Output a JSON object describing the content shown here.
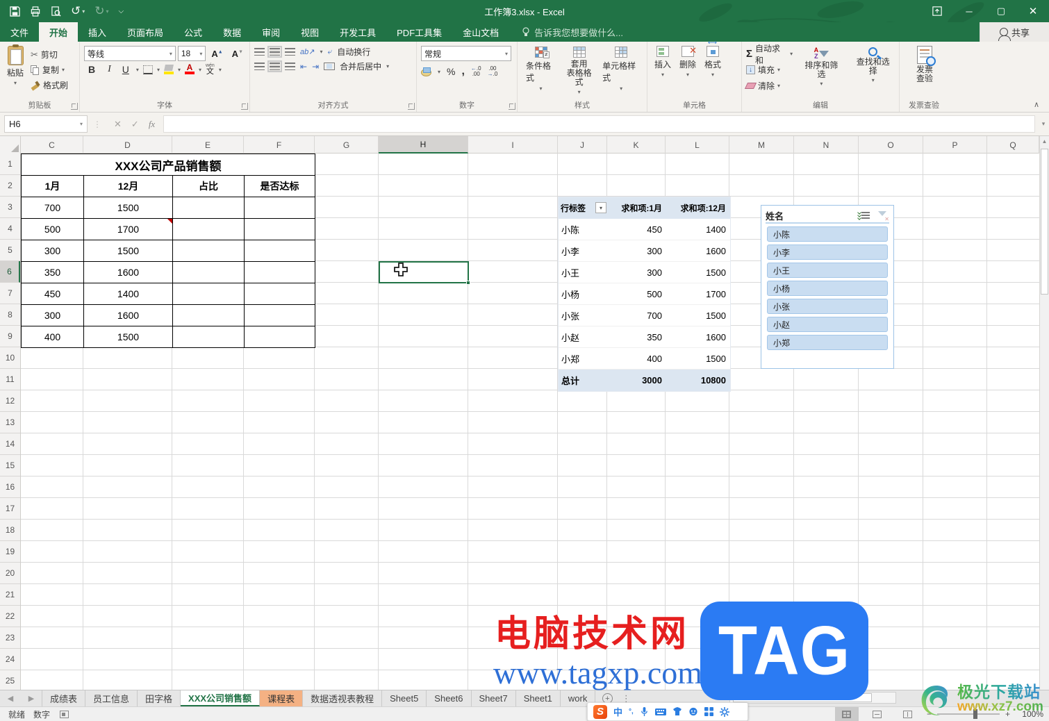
{
  "colors": {
    "excel_green": "#217346",
    "ribbon_bg": "#f4f2ee",
    "pivot_header_bg": "#dce6f1",
    "slicer_border_blue": "#9dc3e6",
    "slicer_item_bg": "#c9ddf1",
    "sheet_tab_highlight": "#f4b183",
    "watermark_red": "#e61f1f",
    "watermark_url_blue": "#2e6fd6",
    "tag_badge_blue": "#2b7bf3"
  },
  "titlebar": {
    "title": "工作簿3.xlsx - Excel"
  },
  "tabs": [
    {
      "label": "文件",
      "file": true
    },
    {
      "label": "开始",
      "active": true
    },
    {
      "label": "插入"
    },
    {
      "label": "页面布局"
    },
    {
      "label": "公式"
    },
    {
      "label": "数据"
    },
    {
      "label": "审阅"
    },
    {
      "label": "视图"
    },
    {
      "label": "开发工具"
    },
    {
      "label": "PDF工具集"
    },
    {
      "label": "金山文档"
    }
  ],
  "tell_me": "告诉我您想要做什么...",
  "share_label": "共享",
  "ribbon": {
    "clipboard": {
      "paste": "粘贴",
      "cut": "剪切",
      "copy": "复制",
      "format_painter": "格式刷",
      "group": "剪贴板"
    },
    "font": {
      "font_name": "等线",
      "font_size": "18",
      "bold": "B",
      "italic": "I",
      "underline": "U",
      "phonetic_hint": "wén",
      "phonetic": "文",
      "group": "字体"
    },
    "alignment": {
      "wrap": "自动换行",
      "merge": "合并后居中",
      "group": "对齐方式"
    },
    "number": {
      "format": "常规",
      "percent": "%",
      "group": "数字"
    },
    "styles": {
      "conditional": "条件格式",
      "format_table": "套用\n表格格式",
      "cell_styles": "单元格样式",
      "group": "样式"
    },
    "cells": {
      "insert": "插入",
      "delete": "删除",
      "format": "格式",
      "group": "单元格"
    },
    "editing": {
      "autosum": "自动求和",
      "fill": "填充",
      "clear": "清除",
      "sort_filter": "排序和筛选",
      "find_select": "查找和选择",
      "group": "编辑"
    },
    "invoice": {
      "line1": "发票",
      "line2": "查验",
      "group": "发票查验"
    }
  },
  "formula_bar": {
    "name_box": "H6",
    "fx": "fx"
  },
  "grid": {
    "columns": [
      {
        "label": "C"
      },
      {
        "label": "D"
      },
      {
        "label": "E"
      },
      {
        "label": "F"
      },
      {
        "label": "G"
      },
      {
        "label": "H",
        "selected": true
      },
      {
        "label": "I"
      },
      {
        "label": "J"
      },
      {
        "label": "K"
      },
      {
        "label": "L"
      },
      {
        "label": "M"
      },
      {
        "label": "N"
      },
      {
        "label": "O"
      },
      {
        "label": "P"
      },
      {
        "label": "Q"
      }
    ],
    "rows": [
      {
        "n": "1"
      },
      {
        "n": "2"
      },
      {
        "n": "3"
      },
      {
        "n": "4"
      },
      {
        "n": "5"
      },
      {
        "n": "6",
        "selected": true
      },
      {
        "n": "7"
      },
      {
        "n": "8"
      },
      {
        "n": "9"
      },
      {
        "n": "10"
      },
      {
        "n": "11"
      },
      {
        "n": "12"
      },
      {
        "n": "13"
      },
      {
        "n": "14"
      },
      {
        "n": "15"
      },
      {
        "n": "16"
      },
      {
        "n": "17"
      },
      {
        "n": "18"
      },
      {
        "n": "19"
      },
      {
        "n": "20"
      },
      {
        "n": "21"
      },
      {
        "n": "22"
      },
      {
        "n": "23"
      },
      {
        "n": "24"
      },
      {
        "n": "25"
      }
    ]
  },
  "sales_table": {
    "title": "XXX公司产品销售额",
    "headers": [
      "1月",
      "12月",
      "占比",
      "是否达标"
    ],
    "rows": [
      [
        "700",
        "1500",
        "",
        ""
      ],
      [
        "500",
        "1700",
        "",
        ""
      ],
      [
        "300",
        "1500",
        "",
        ""
      ],
      [
        "350",
        "1600",
        "",
        ""
      ],
      [
        "450",
        "1400",
        "",
        ""
      ],
      [
        "300",
        "1600",
        "",
        ""
      ],
      [
        "400",
        "1500",
        "",
        ""
      ]
    ]
  },
  "pivot": {
    "headers": [
      "行标签",
      "求和项:1月",
      "求和项:12月"
    ],
    "rows": [
      [
        "小陈",
        "450",
        "1400"
      ],
      [
        "小李",
        "300",
        "1600"
      ],
      [
        "小王",
        "300",
        "1500"
      ],
      [
        "小杨",
        "500",
        "1700"
      ],
      [
        "小张",
        "700",
        "1500"
      ],
      [
        "小赵",
        "350",
        "1600"
      ],
      [
        "小郑",
        "400",
        "1500"
      ]
    ],
    "total": [
      "总计",
      "3000",
      "10800"
    ]
  },
  "slicer": {
    "title": "姓名",
    "items": [
      {
        "label": "小陈"
      },
      {
        "label": "小李"
      },
      {
        "label": "小王"
      },
      {
        "label": "小杨"
      },
      {
        "label": "小张"
      },
      {
        "label": "小赵"
      },
      {
        "label": "小郑"
      }
    ]
  },
  "sheet_tabs": [
    {
      "label": "成绩表"
    },
    {
      "label": "员工信息"
    },
    {
      "label": "田字格"
    },
    {
      "label": "XXX公司销售额",
      "active": true
    },
    {
      "label": "课程表",
      "highlight": true
    },
    {
      "label": "数据透视表教程"
    },
    {
      "label": "Sheet5"
    },
    {
      "label": "Sheet6"
    },
    {
      "label": "Sheet7"
    },
    {
      "label": "Sheet1"
    },
    {
      "label": "work"
    }
  ],
  "status_bar": {
    "ready": "就绪",
    "mode": "数字",
    "zoom": "100%"
  },
  "ime": {
    "mode_glyph": "中",
    "punct_glyph": "°,"
  },
  "watermarks": {
    "site_name": "电脑技术网",
    "site_url": "www.tagxp.com",
    "badge": "TAG",
    "download_site": "极光下载站",
    "download_url": "www.xz7.com"
  }
}
